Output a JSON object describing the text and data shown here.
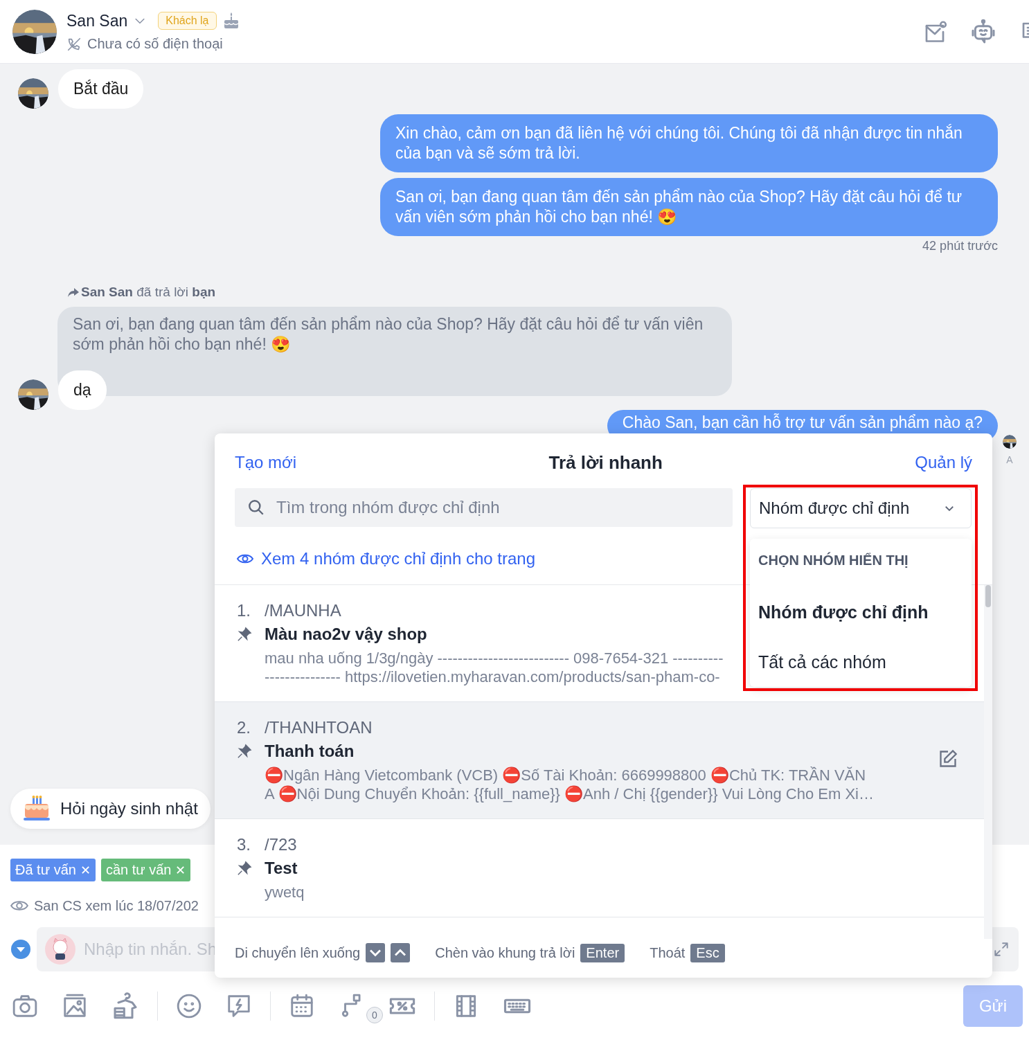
{
  "header": {
    "name": "San San",
    "badge": "Khách lạ",
    "phone": "Chưa có số điện thoại"
  },
  "messages": [
    {
      "kind": "incoming",
      "text": "Bắt đầu",
      "avatar": true
    },
    {
      "kind": "outgoing",
      "text": "Xin chào, cảm ơn bạn đã liên hệ với chúng tôi. Chúng tôi đã nhận được tin nhắn của bạn và sẽ sớm trả lời."
    },
    {
      "kind": "outgoing",
      "text": "San ơi, bạn đang quan tâm đến sản phẩm nào của Shop? Hãy đặt câu hỏi để tư vấn viên sớm phản hồi cho bạn nhé! 😍"
    },
    {
      "kind": "time",
      "text": "42 phút trước"
    },
    {
      "kind": "reply_note",
      "text": "**San San** đã trả lời **bạn**"
    },
    {
      "kind": "quote",
      "text": "San ơi, bạn đang quan tâm đến sản phẩm nào của Shop? Hãy đặt câu hỏi để tư vấn viên sớm phản hồi cho bạn nhé! 😍"
    },
    {
      "kind": "incoming",
      "text": "dạ",
      "avatar": true
    },
    {
      "kind": "outgoing",
      "text": "Chào San, bạn cần hỗ trợ tư vấn sản phẩm nào ạ?",
      "sender": "A"
    }
  ],
  "suggestion": "Hỏi ngày sinh nhật",
  "tags": [
    {
      "label": "Đã tư vấn",
      "remove": "✕",
      "color": "#5b8def"
    },
    {
      "label": "cần tư vấn",
      "remove": "✕",
      "color": "#66bb7a"
    }
  ],
  "seen": "San CS xem lúc 18/07/202",
  "composer": {
    "placeholder": "Nhập tin nhắn. Sh"
  },
  "toolbar_badge": "0",
  "send_button": "Gửi",
  "quick_reply": {
    "create": "Tạo mới",
    "title": "Trả lời nhanh",
    "manage": "Quản lý",
    "search": {
      "placeholder": "Tìm trong nhóm được chỉ định"
    },
    "group_select": {
      "value": "Nhóm được chỉ định",
      "expanded": true,
      "heading": "CHỌN NHÓM HIỂN THỊ",
      "options": [
        {
          "label": "Nhóm được chỉ định",
          "selected": true
        },
        {
          "label": "Tất cả các nhóm",
          "selected": false
        }
      ]
    },
    "view_link": "Xem 4 nhóm được chỉ định cho trang",
    "items": [
      {
        "number": "1.",
        "shortcut": "/MAUNHA",
        "title": "Màu nao2v vậy shop",
        "content": "mau nha uống 1/3g/ngày -------------------------- 098-7654-321 ----------\n--------------- https://ilovetien.myharavan.com/products/san-pham-co-",
        "selected": false
      },
      {
        "number": "2.",
        "shortcut": "/THANHTOAN",
        "title": "Thanh toán",
        "content": "⛔Ngân Hàng Vietcombank (VCB) ⛔Số Tài Khoản: 6669998800 ⛔Chủ TK: TRẦN VĂN\nA ⛔Nội Dung Chuyển Khoản: {{full_name}} ⛔Anh / Chị {{gender}} Vui Lòng Cho Em Xi…",
        "selected": true
      },
      {
        "number": "3.",
        "shortcut": "/723",
        "title": "Test",
        "content": "ywetq",
        "selected": false
      }
    ],
    "hints": [
      {
        "kind": "arrows",
        "label": "Di chuyển lên xuống"
      },
      {
        "kind": "key",
        "label": "Chèn vào khung trả lời",
        "key": "Enter"
      },
      {
        "kind": "key",
        "label": "Thoát",
        "key": "Esc"
      }
    ]
  }
}
